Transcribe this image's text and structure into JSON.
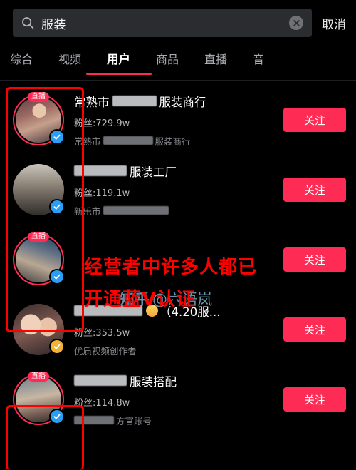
{
  "search": {
    "value": "服装",
    "clear_label": "clear",
    "cancel_label": "取消"
  },
  "tabs": [
    {
      "label": "综合",
      "active": false
    },
    {
      "label": "视频",
      "active": false
    },
    {
      "label": "用户",
      "active": true
    },
    {
      "label": "商品",
      "active": false
    },
    {
      "label": "直播",
      "active": false
    },
    {
      "label": "音",
      "active": false
    }
  ],
  "live_badge_label": "直播",
  "follow_label": "关注",
  "users": [
    {
      "name_prefix": "常熟市",
      "name_suffix": "服装商行",
      "fans": "粉丝:729.9w",
      "sub_prefix": "常熟市",
      "sub_suffix": "服装商行",
      "live": true,
      "verified": "blue"
    },
    {
      "name_prefix": "",
      "name_suffix": "服装工厂",
      "fans": "粉丝:119.1w",
      "sub_prefix": "新乐市",
      "sub_suffix": "",
      "live": false,
      "verified": "blue"
    },
    {
      "name_prefix": "",
      "name_suffix": "",
      "fans": "",
      "sub_prefix": "",
      "sub_suffix": "",
      "live": true,
      "verified": "blue"
    },
    {
      "name_prefix": "",
      "name_suffix": "（4.20服...",
      "fans": "粉丝:353.5w",
      "sub_prefix": "优质视频创作者",
      "sub_suffix": "",
      "live": false,
      "verified": "yellow"
    },
    {
      "name_prefix": "",
      "name_suffix": "服装搭配",
      "fans": "粉丝:114.8w",
      "sub_prefix": "",
      "sub_suffix": "方官账号",
      "live": true,
      "verified": "blue"
    }
  ],
  "annotation": {
    "line1": "经营者中许多人都已",
    "line2": "开通蓝V认证"
  },
  "watermark": {
    "logo": "知乎",
    "text": "@六语岚"
  },
  "colors": {
    "accent": "#fe2c55",
    "annotation": "#ff0000",
    "verified_blue": "#2a9df4",
    "verified_yellow": "#f2b233",
    "background": "#000000"
  }
}
